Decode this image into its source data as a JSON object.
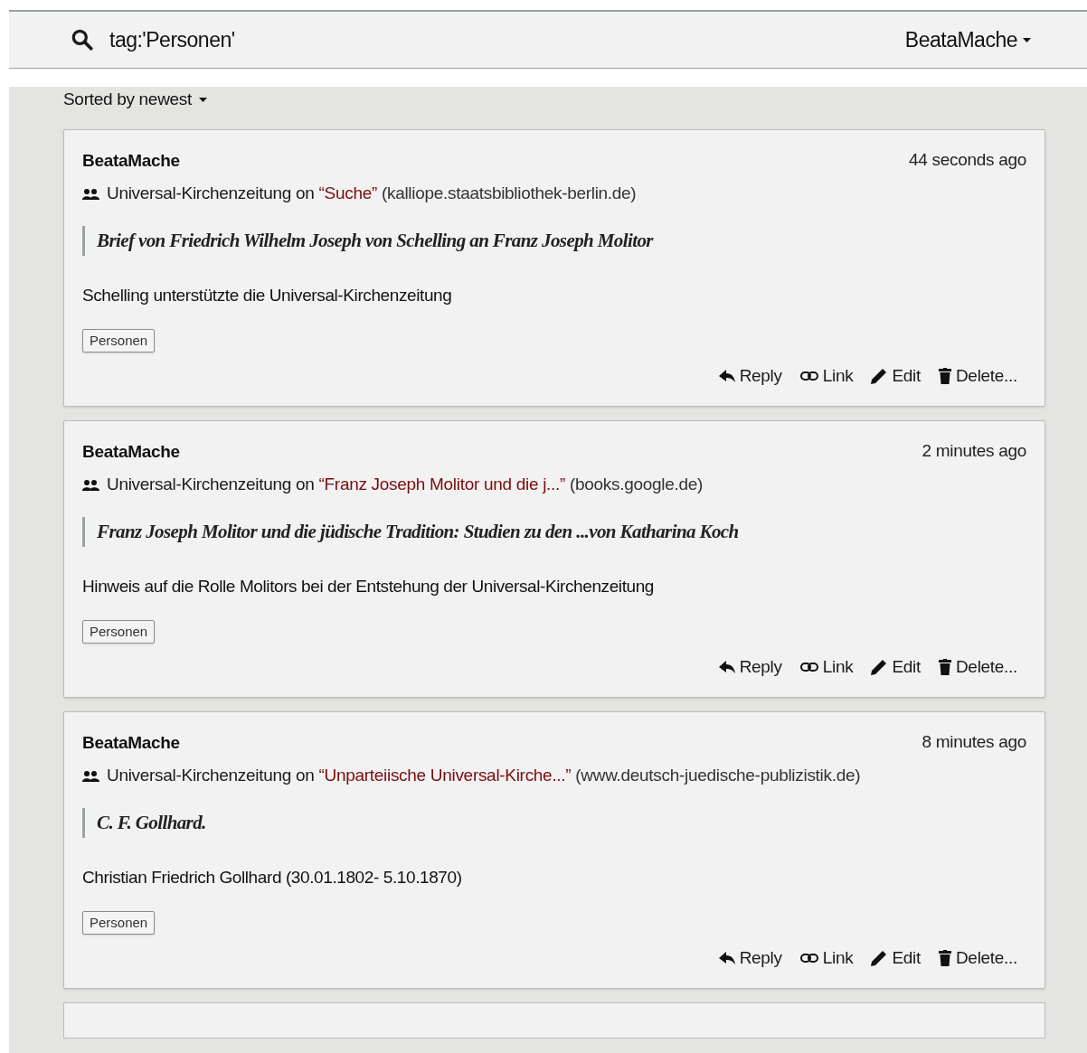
{
  "search": {
    "value": "tag:'Personen'"
  },
  "user_menu": {
    "label": "BeataMache"
  },
  "sort": {
    "label": "Sorted by newest"
  },
  "annotations": [
    {
      "user": "BeataMache",
      "time": "44 seconds ago",
      "group": "Universal-Kirchenzeitung",
      "on": "on",
      "doc_title": "“Suche”",
      "source": "(kalliope.staatsbibliothek-berlin.de)",
      "quote": "Brief von Friedrich Wilhelm Joseph von Schelling an Franz Joseph Molitor",
      "text": "Schelling unterstützte die Universal-Kirchenzeitung",
      "tags": [
        "Personen"
      ],
      "actions": [
        "Reply",
        "Link",
        "Edit",
        "Delete..."
      ]
    },
    {
      "user": "BeataMache",
      "time": "2 minutes ago",
      "group": "Universal-Kirchenzeitung",
      "on": "on",
      "doc_title": "“Franz Joseph Molitor und die j...”",
      "source": "(books.google.de)",
      "quote": "Franz Joseph Molitor und die jüdische Tradition: Studien zu den ...von Katharina Koch",
      "text": "Hinweis auf die Rolle Molitors bei der Entstehung der Universal-Kirchenzeitung",
      "tags": [
        "Personen"
      ],
      "actions": [
        "Reply",
        "Link",
        "Edit",
        "Delete..."
      ]
    },
    {
      "user": "BeataMache",
      "time": "8 minutes ago",
      "group": "Universal-Kirchenzeitung",
      "on": "on",
      "doc_title": "“Unparteiische Universal-Kirche...”",
      "source": "(www.deutsch-juedische-publizistik.de)",
      "quote": "C. F. Gollhard.",
      "text": "Christian Friedrich Gollhard (30.01.1802- 5.10.1870)",
      "tags": [
        "Personen"
      ],
      "actions": [
        "Reply",
        "Link",
        "Edit",
        "Delete..."
      ]
    }
  ]
}
